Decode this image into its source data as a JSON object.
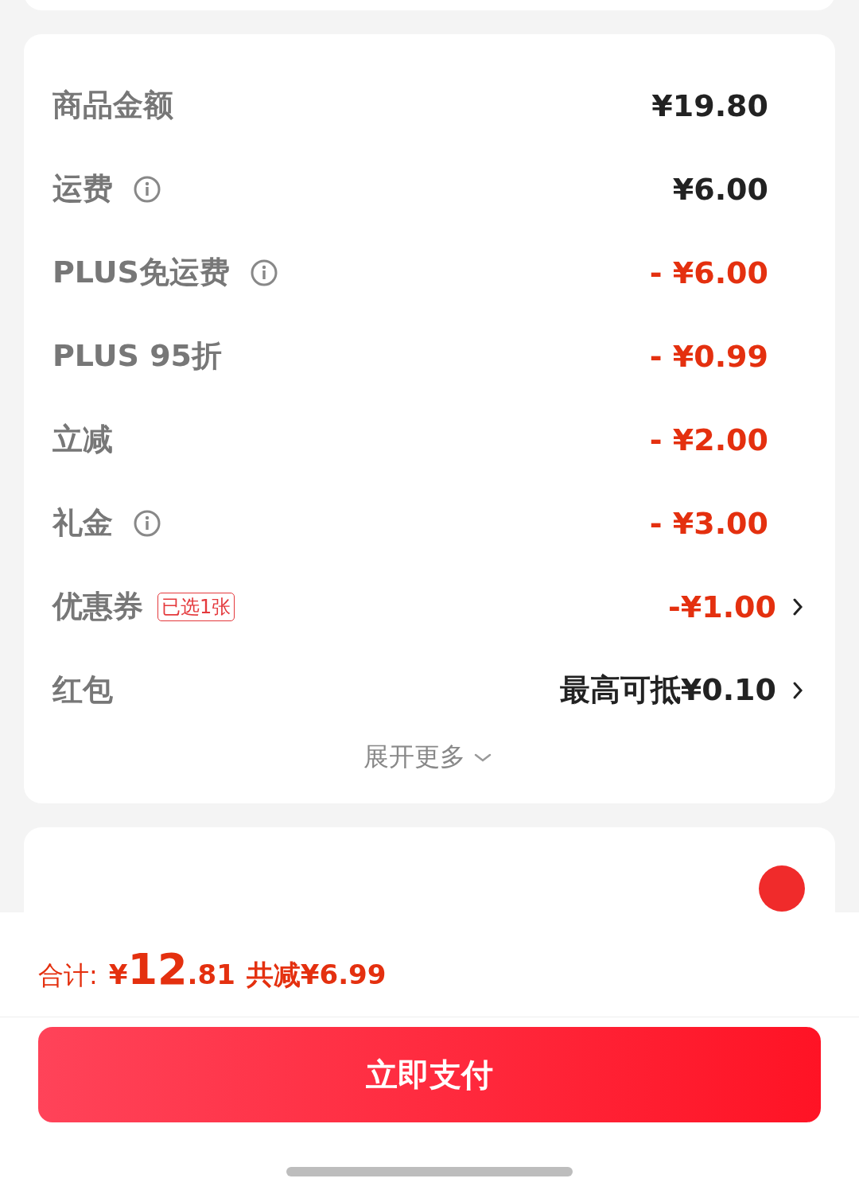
{
  "rows": [
    {
      "label": "商品金额",
      "info": false,
      "value": "¥19.80",
      "discount": false,
      "chevron": false
    },
    {
      "label": "运费",
      "info": true,
      "value": "¥6.00",
      "discount": false,
      "chevron": false
    },
    {
      "label": "PLUS免运费",
      "info": true,
      "value": "- ¥6.00",
      "discount": true,
      "chevron": false
    },
    {
      "label": "PLUS 95折",
      "info": false,
      "value": "- ¥0.99",
      "discount": true,
      "chevron": false
    },
    {
      "label": "立减",
      "info": false,
      "value": "- ¥2.00",
      "discount": true,
      "chevron": false
    },
    {
      "label": "礼金",
      "info": true,
      "value": "- ¥3.00",
      "discount": true,
      "chevron": false
    },
    {
      "label": "优惠券",
      "info": false,
      "tag": "已选1张",
      "value": "-¥1.00",
      "discount": true,
      "chevron": true
    },
    {
      "label": "红包",
      "info": false,
      "value": "最高可抵¥0.10",
      "discount": false,
      "chevron": true
    }
  ],
  "expand": {
    "label": "展开更多",
    "expanded": false
  },
  "payment_method": {
    "selected": true
  },
  "total": {
    "label": "合计:",
    "currency": "¥",
    "integer": "12",
    "decimal": ".81",
    "saving": "共减¥6.99"
  },
  "pay_button": "立即支付"
}
